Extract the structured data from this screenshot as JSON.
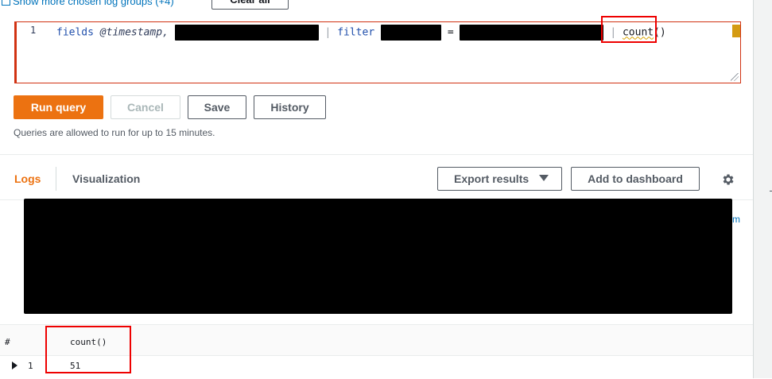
{
  "top": {
    "show_more_label": "Show more chosen log groups (+4)",
    "clear_all_label": "Clear all"
  },
  "editor": {
    "line_number": "1",
    "tokens": {
      "fields": "fields",
      "timestamp": "@timestamp,",
      "pipe": "|",
      "filter": "filter",
      "equals": "=",
      "count": "count",
      "parens": "()"
    }
  },
  "actions": {
    "run_query": "Run query",
    "cancel": "Cancel",
    "save": "Save",
    "history": "History",
    "note": "Queries are allowed to run for up to 15 minutes."
  },
  "results": {
    "tabs": [
      "Logs",
      "Visualization"
    ],
    "export_label": "Export results",
    "add_dashboard_label": "Add to dashboard",
    "partial_link": "m",
    "table": {
      "columns": [
        "#",
        "count()"
      ],
      "rows": [
        {
          "index": "1",
          "count": "51"
        }
      ]
    }
  },
  "colors": {
    "primary": "#ec7211",
    "link": "#0073bb",
    "error": "#d13212",
    "highlight": "#e00000"
  }
}
